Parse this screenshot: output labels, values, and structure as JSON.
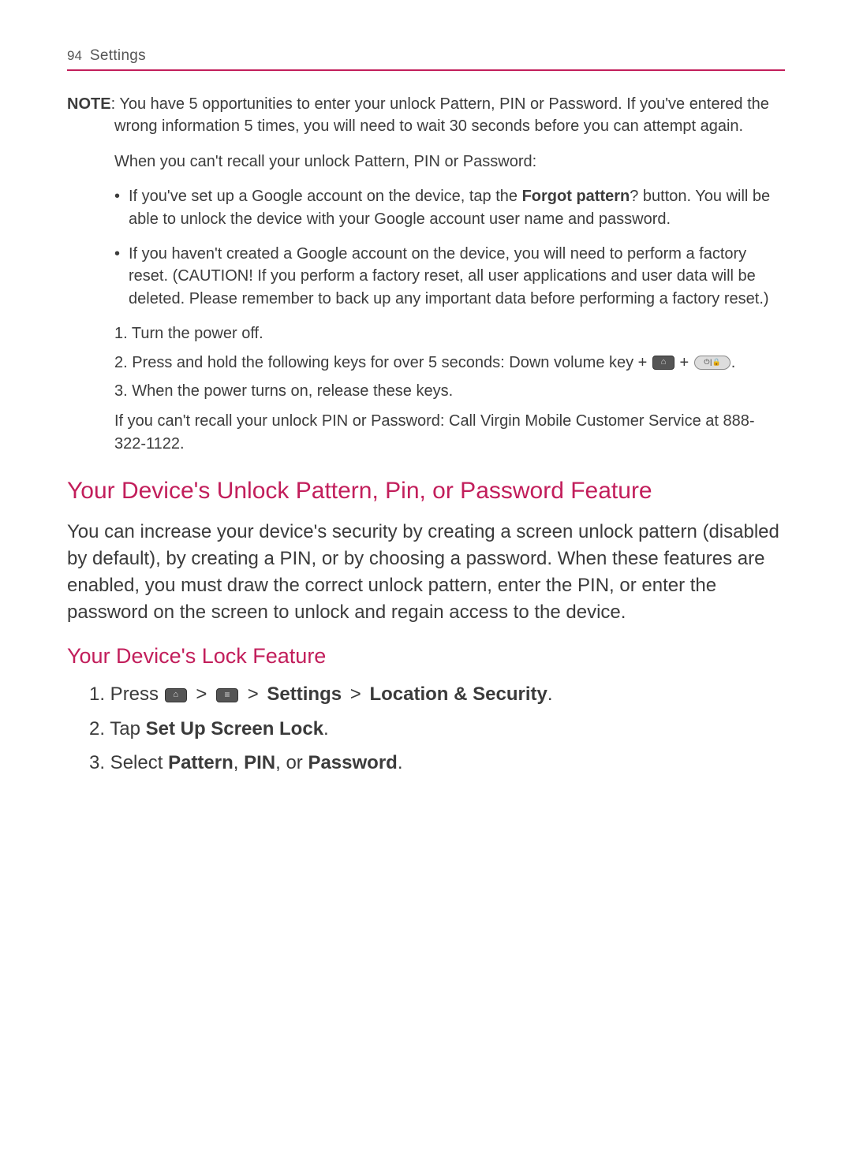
{
  "header": {
    "page_number": "94",
    "section": "Settings"
  },
  "note": {
    "label": "NOTE",
    "intro": ": You have 5 opportunities to enter your unlock Pattern, PIN or Password. If you've entered the wrong information 5 times, you will need to wait 30 seconds before you can attempt again.",
    "recall_intro": "When you can't recall your unlock Pattern, PIN or Password:",
    "bullets": {
      "b1_pre": "If you've set up a Google account on the device, tap the ",
      "b1_bold": "Forgot pattern",
      "b1_post": "? button. You will be able to unlock the device with your Google account user name and password.",
      "b2": "If you haven't created a Google account on the device, you will need to perform a factory reset. (CAUTION! If you perform a factory reset, all user applications and user data will be deleted. Please remember to back up any important data before performing a factory reset.)"
    },
    "steps": {
      "s1": "1. Turn the power off.",
      "s2_pre": "2. Press and hold the following keys for over 5 seconds: Down volume key + ",
      "s2_plus": " + ",
      "s2_post": ".",
      "s3": "3. When the power turns on, release these keys."
    },
    "recall_pin": "If you can't recall your unlock PIN or Password: Call Virgin Mobile Customer Service at 888-322-1122."
  },
  "section1": {
    "title": "Your Device's Unlock Pattern, Pin, or Password Feature",
    "body": "You can increase your device's security by creating a screen unlock pattern (disabled by default), by creating a PIN, or by choosing a password. When these features are enabled, you must draw the correct unlock pattern, enter the PIN, or enter the password on the screen to unlock and regain access to the device."
  },
  "section2": {
    "title": "Your Device's Lock Feature",
    "steps": {
      "s1_pre": "1. Press ",
      "gt": " > ",
      "settings": "Settings",
      "locsec": "Location & Security",
      "period": ".",
      "s2_pre": "2. Tap ",
      "s2_bold": "Set Up Screen Lock",
      "s3_pre": "3. Select ",
      "pattern": "Pattern",
      "comma": ", ",
      "pin": "PIN",
      "or": ", or ",
      "password": "Password"
    }
  }
}
